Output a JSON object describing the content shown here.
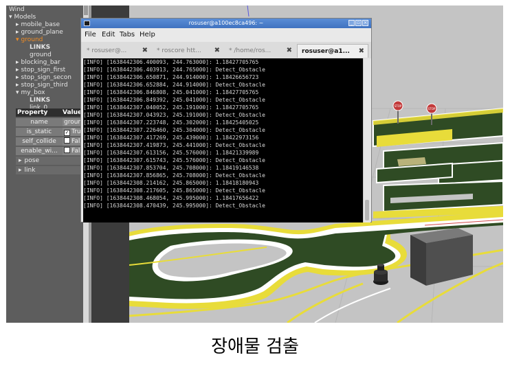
{
  "gazebo": {
    "tree": [
      {
        "label": "Wind",
        "indent": 0,
        "arrow": "",
        "style": ""
      },
      {
        "label": "Models",
        "indent": 0,
        "arrow": "▾",
        "style": ""
      },
      {
        "label": "mobile_base",
        "indent": 1,
        "arrow": "▸",
        "style": ""
      },
      {
        "label": "ground_plane",
        "indent": 1,
        "arrow": "▸",
        "style": ""
      },
      {
        "label": "ground",
        "indent": 1,
        "arrow": "▾",
        "style": "orange"
      },
      {
        "label": "LINKS",
        "indent": 3,
        "arrow": "",
        "style": "bold"
      },
      {
        "label": "ground",
        "indent": 3,
        "arrow": "",
        "style": ""
      },
      {
        "label": "blocking_bar",
        "indent": 1,
        "arrow": "▸",
        "style": ""
      },
      {
        "label": "stop_sign_first",
        "indent": 1,
        "arrow": "▸",
        "style": ""
      },
      {
        "label": "stop_sign_secon",
        "indent": 1,
        "arrow": "▸",
        "style": ""
      },
      {
        "label": "stop_sign_third",
        "indent": 1,
        "arrow": "▸",
        "style": ""
      },
      {
        "label": "my_box",
        "indent": 1,
        "arrow": "▾",
        "style": ""
      },
      {
        "label": "LINKS",
        "indent": 3,
        "arrow": "",
        "style": "bold"
      },
      {
        "label": "link_0",
        "indent": 3,
        "arrow": "",
        "style": ""
      }
    ],
    "properties": {
      "header_property": "Property",
      "header_value": "Value",
      "rows": [
        {
          "key": "name",
          "value": "ground",
          "checkbox": false,
          "checked": false
        },
        {
          "key": "is_static",
          "value": "True",
          "checkbox": true,
          "checked": true
        },
        {
          "key": "self_collide",
          "value": "False",
          "checkbox": true,
          "checked": false
        },
        {
          "key": "enable_wi...",
          "value": "False",
          "checkbox": true,
          "checked": false
        }
      ],
      "sections": [
        "pose",
        "link"
      ]
    }
  },
  "terminal": {
    "title": "rosuser@a100ec8ca496: ~",
    "menu": [
      "File",
      "Edit",
      "Tabs",
      "Help"
    ],
    "tabs": [
      {
        "label": "rosuser@...",
        "active": false
      },
      {
        "label": "roscore htt...",
        "active": false
      },
      {
        "label": "/home/ros...",
        "active": false
      },
      {
        "label": "rosuser@a1...",
        "active": true
      }
    ],
    "log_lines": [
      "[INFO] [1638442306.400093, 244.763000]: 1.18427705765",
      "[INFO] [1638442306.403913, 244.765000]: Detect_Obstacle",
      "[INFO] [1638442306.650871, 244.914000]: 1.18426656723",
      "[INFO] [1638442306.652884, 244.914000]: Detect_Obstacle",
      "[INFO] [1638442306.846808, 245.041000]: 1.18427705765",
      "[INFO] [1638442306.849392, 245.041000]: Detect_Obstacle",
      "[INFO] [1638442307.040052, 245.191000]: 1.18427705765",
      "[INFO] [1638442307.043923, 245.191000]: Detect_Obstacle",
      "[INFO] [1638442307.223748, 245.302000]: 1.18425405025",
      "[INFO] [1638442307.226460, 245.304000]: Detect_Obstacle",
      "[INFO] [1638442307.417269, 245.439000]: 1.18422973156",
      "[INFO] [1638442307.419873, 245.441000]: Detect_Obstacle",
      "[INFO] [1638442307.613156, 245.576000]: 1.18421339989",
      "[INFO] [1638442307.615743, 245.576000]: Detect_Obstacle",
      "[INFO] [1638442307.853704, 245.708000]: 1.18419146538",
      "[INFO] [1638442307.856865, 245.708000]: Detect_Obstacle",
      "[INFO] [1638442308.214162, 245.865000]: 1.18418180943",
      "[INFO] [1638442308.217605, 245.865000]: Detect_Obstacle",
      "[INFO] [1638442308.468054, 245.995000]: 1.18417656422",
      "[INFO] [1638442308.470439, 245.995000]: Detect_Obstacle"
    ]
  },
  "scene": {
    "stop_sign_label": "STOP",
    "colors": {
      "ground": "#c4c4c4",
      "grass": "#2f4b24",
      "yellow_line": "#e8dc3a",
      "box": "#4f4f4f"
    }
  },
  "caption": "장애물 검출"
}
